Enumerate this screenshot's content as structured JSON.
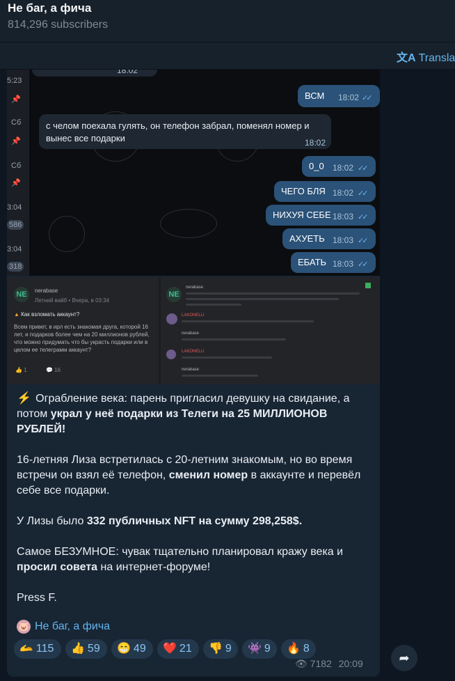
{
  "header": {
    "title": "Не баг, а фича",
    "subscribers": "814,296 subscribers"
  },
  "toolbar": {
    "translate_icon": "文A",
    "translate_label": "Translat"
  },
  "chat_screenshot": {
    "side_times": [
      "5:23",
      "Сб",
      "Сб",
      "3:04",
      "3:04"
    ],
    "side_badges": [
      "586",
      "318"
    ],
    "top_time": "18:02",
    "messages": [
      {
        "text": "ВСМ",
        "time": "18:02",
        "out": true
      },
      {
        "text": "с челом поехала гулять, он телефон забрал, поменял номер и вынес все подарки",
        "time": "18:02",
        "out": false
      },
      {
        "text": "0_0",
        "time": "18:02",
        "out": true
      },
      {
        "text": "ЧЕГО БЛЯ",
        "time": "18:02",
        "out": true
      },
      {
        "text": "НИХУЯ СЕБЕ",
        "time": "18:03",
        "out": true
      },
      {
        "text": "АХУЕТЬ",
        "time": "18:03",
        "out": true
      },
      {
        "text": "ЕБАТЬ",
        "time": "18:03",
        "out": true
      }
    ],
    "check_icon": "✓✓"
  },
  "forum_screenshot": {
    "left": {
      "avatar": "NE",
      "user": "nerabase",
      "meta": "Летний вайб • Вчера, в 03:34",
      "question": "Как взломать аккаунт?",
      "body": "Всем привет, в ирл есть знакомая друга, которой 16 лет, и подарков более чем на 20 миллионов рублей, что можно придумать что бы украсть подарки или в целом ее телеграмм аккаунт?",
      "likes": "1",
      "comments": "16"
    },
    "right": {
      "avatar": "NE",
      "user": "nerabase",
      "user2": "LAKONELLI",
      "user3": "nerabase",
      "user4": "LAKONELLI",
      "user5": "nerabase"
    }
  },
  "post": {
    "lead_icon": "⚡",
    "p1_a": "Ограбление века: парень пригласил девушку на свидание, а потом ",
    "p1_b": "украл у неё подарки из Телеги на 25 МИЛЛИОНОВ РУБЛЕЙ!",
    "p2_a": "16-летняя Лиза встретилась с 20-летним знакомым, но во время встречи он взял её телефон, ",
    "p2_b": "сменил номер",
    "p2_c": " в аккаунте и перевёл себе все подарки.",
    "p3_a": "У Лизы было ",
    "p3_b": "332 публичных NFT на сумму 298,258$.",
    "p4_a": "Самое БЕЗУМНОЕ: чувак тщательно планировал кражу века и ",
    "p4_b": "просил совета",
    "p4_c": " на интернет-форуме!",
    "p5": "Press F.",
    "signature": "Не баг, а фича"
  },
  "reactions": [
    {
      "icon": "🫴",
      "count": "115"
    },
    {
      "icon": "👍",
      "count": "59"
    },
    {
      "icon": "😁",
      "count": "49"
    },
    {
      "icon": "❤️",
      "count": "21"
    },
    {
      "icon": "👎",
      "count": "9"
    },
    {
      "icon": "👾",
      "count": "9"
    },
    {
      "icon": "🔥",
      "count": "8"
    }
  ],
  "meta": {
    "eye_icon": "👁",
    "views": "7182",
    "time": "20:09"
  },
  "share_icon": "➦",
  "colors": {
    "background": "#0e1621",
    "bubble": "#182533",
    "accent": "#64b5ef",
    "outgoing": "#2b5278"
  }
}
